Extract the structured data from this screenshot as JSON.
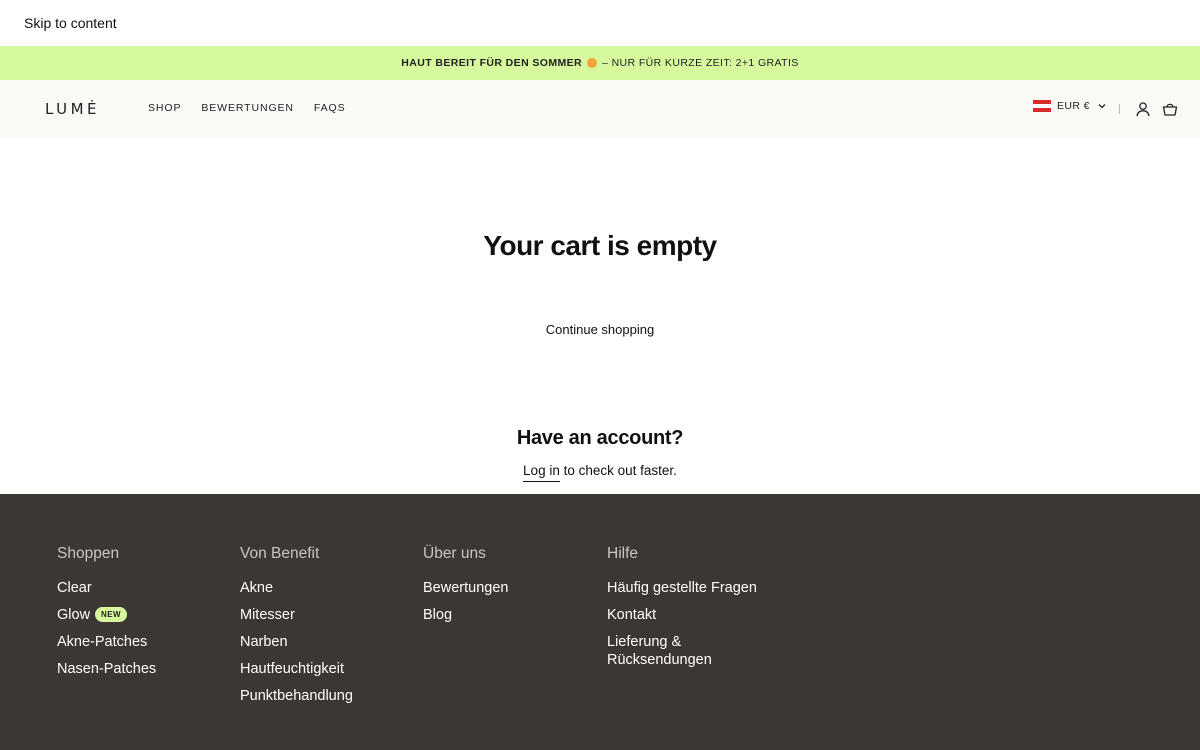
{
  "skip_link": "Skip to content",
  "announcement": {
    "bold_text": "HAUT BEREIT FÜR DEN SOMMER",
    "emoji": "orange-circle",
    "rest_text": "– NUR FÜR KURZE ZEIT: 2+1 GRATIS",
    "background": "#d6f99d"
  },
  "header": {
    "logo": "LUMĖ",
    "nav": [
      "SHOP",
      "BEWERTUNGEN",
      "FAQS"
    ],
    "currency": "EUR €",
    "flag": "austria-flag",
    "icons": [
      "account-icon",
      "cart-icon"
    ]
  },
  "main": {
    "title": "Your cart is empty",
    "continue_label": "Continue shopping",
    "account_title": "Have an account?",
    "login_link": "Log in",
    "login_suffix": "to check out faster."
  },
  "footer": {
    "background": "#3c3733",
    "columns": [
      {
        "heading": "Shoppen",
        "items": [
          "Clear",
          "Glow",
          "Akne-Patches",
          "Nasen-Patches"
        ],
        "badge": "NEW"
      },
      {
        "heading": "Von Benefit",
        "items": [
          "Akne",
          "Mitesser",
          "Narben",
          "Hautfeuchtigkeit",
          "Punktbehandlung"
        ]
      },
      {
        "heading": "Über uns",
        "items": [
          "Bewertungen",
          "Blog"
        ]
      },
      {
        "heading": "Hilfe",
        "items": [
          "Häufig gestellte Fragen",
          "Kontakt",
          "Lieferung & Rücksendungen"
        ]
      }
    ]
  }
}
